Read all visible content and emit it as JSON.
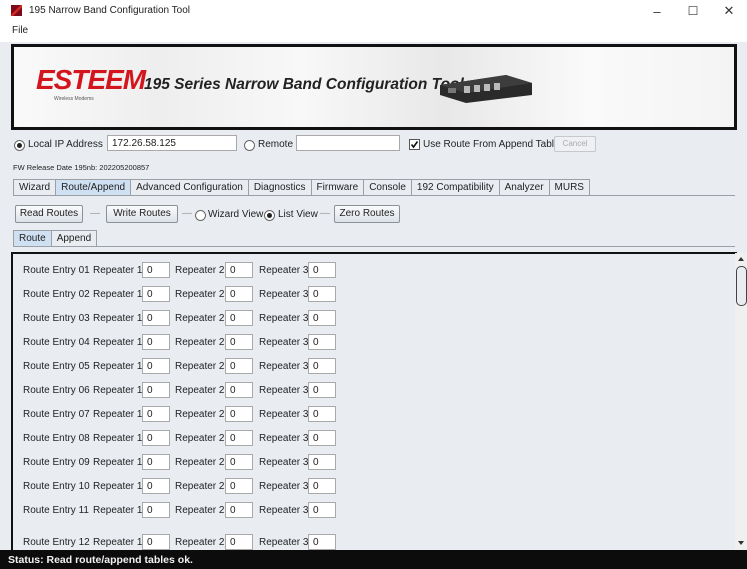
{
  "window": {
    "title": "195 Narrow Band Configuration Tool",
    "controls": {
      "minimize": "–",
      "maximize": "☐",
      "close": "✕"
    }
  },
  "menu": {
    "file": "File"
  },
  "banner": {
    "logo_text": "ESTEEM",
    "logo_subtext": "Wireless Modems",
    "title": "195 Series Narrow Band Configuration Tool"
  },
  "connection": {
    "local_label": "Local IP Address",
    "local_value": "172.26.58.125",
    "local_selected": true,
    "remote_label": "Remote",
    "remote_value": "",
    "use_route_label": "Use Route From Append Table",
    "use_route_checked": true,
    "cancel_label": "Cancel"
  },
  "fw_release": "FW Release Date 195nb: 202205200857",
  "main_tabs": [
    {
      "label": "Wizard",
      "active": false
    },
    {
      "label": "Route/Append",
      "active": true
    },
    {
      "label": "Advanced Configuration",
      "active": false
    },
    {
      "label": "Diagnostics",
      "active": false
    },
    {
      "label": "Firmware",
      "active": false
    },
    {
      "label": "Console",
      "active": false
    },
    {
      "label": "192 Compatibility",
      "active": false
    },
    {
      "label": "Analyzer",
      "active": false
    },
    {
      "label": "MURS",
      "active": false
    }
  ],
  "toolbar": {
    "read_routes": "Read Routes",
    "write_routes": "Write Routes",
    "wizard_view": "Wizard View",
    "list_view": "List View",
    "list_view_selected": true,
    "zero_routes": "Zero Routes",
    "separator": "—"
  },
  "sub_tabs": [
    {
      "label": "Route",
      "active": true
    },
    {
      "label": "Append",
      "active": false
    }
  ],
  "routes": {
    "repeater1_label": "Repeater 1",
    "repeater2_label": "Repeater 2",
    "repeater3_label": "Repeater 3",
    "entries": [
      {
        "label": "Route Entry 01",
        "r1": "0",
        "r2": "0",
        "r3": "0"
      },
      {
        "label": "Route Entry 02",
        "r1": "0",
        "r2": "0",
        "r3": "0"
      },
      {
        "label": "Route Entry 03",
        "r1": "0",
        "r2": "0",
        "r3": "0"
      },
      {
        "label": "Route Entry 04",
        "r1": "0",
        "r2": "0",
        "r3": "0"
      },
      {
        "label": "Route Entry 05",
        "r1": "0",
        "r2": "0",
        "r3": "0"
      },
      {
        "label": "Route Entry 06",
        "r1": "0",
        "r2": "0",
        "r3": "0"
      },
      {
        "label": "Route Entry 07",
        "r1": "0",
        "r2": "0",
        "r3": "0"
      },
      {
        "label": "Route Entry 08",
        "r1": "0",
        "r2": "0",
        "r3": "0"
      },
      {
        "label": "Route Entry 09",
        "r1": "0",
        "r2": "0",
        "r3": "0"
      },
      {
        "label": "Route Entry 10",
        "r1": "0",
        "r2": "0",
        "r3": "0"
      },
      {
        "label": "Route Entry 11",
        "r1": "0",
        "r2": "0",
        "r3": "0"
      },
      {
        "label": "Route Entry 12",
        "r1": "0",
        "r2": "0",
        "r3": "0"
      }
    ]
  },
  "status": "Status: Read route/append tables ok.",
  "colors": {
    "logo": "#d3161d",
    "active_tab": "#cfe0f3",
    "statusbar": "#0c0c0c"
  }
}
